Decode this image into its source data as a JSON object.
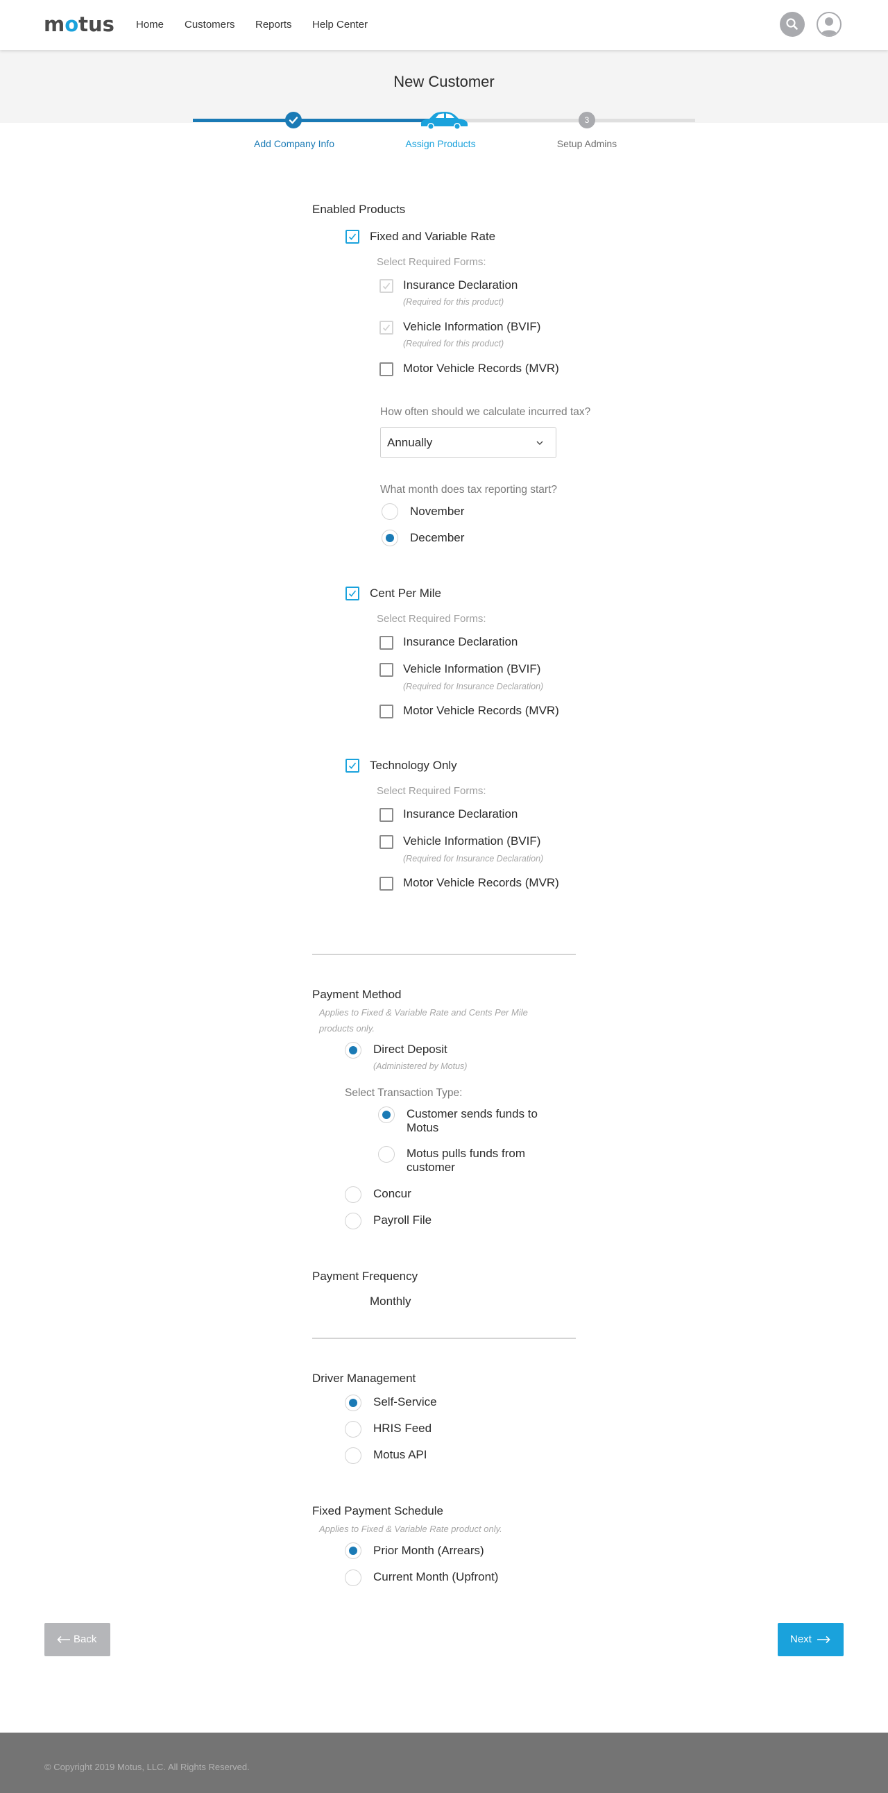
{
  "brand": {
    "logo_prefix": "m",
    "logo_o": "o",
    "logo_suffix": "tus",
    "accent": "#1aa2dc",
    "primary": "#1a7ab5"
  },
  "nav": {
    "items": [
      "Home",
      "Customers",
      "Reports",
      "Help Center"
    ]
  },
  "page": {
    "title": "New Customer"
  },
  "stepper": {
    "steps": [
      {
        "label": "Add Company Info",
        "state": "complete"
      },
      {
        "label": "Assign Products",
        "state": "active"
      },
      {
        "label": "Setup Admins",
        "state": "pending",
        "number": "3"
      }
    ]
  },
  "enabled_products": {
    "title": "Enabled Products",
    "products": [
      {
        "name": "Fixed and Variable Rate",
        "checked": true,
        "forms_label": "Select Required Forms:",
        "forms": [
          {
            "name": "Insurance Declaration",
            "note": "(Required for this product)",
            "state": "disabled-checked"
          },
          {
            "name": "Vehicle Information (BVIF)",
            "note": "(Required for this product)",
            "state": "disabled-checked"
          },
          {
            "name": "Motor Vehicle Records (MVR)",
            "state": "unchecked"
          }
        ],
        "tax_question": "How often should we calculate incurred tax?",
        "tax_select_value": "Annually",
        "month_question": "What month does tax reporting start?",
        "month_options": [
          {
            "label": "November",
            "selected": false
          },
          {
            "label": "December",
            "selected": true
          }
        ]
      },
      {
        "name": "Cent Per Mile",
        "checked": true,
        "forms_label": "Select Required Forms:",
        "forms": [
          {
            "name": "Insurance Declaration",
            "state": "unchecked"
          },
          {
            "name": "Vehicle Information (BVIF)",
            "note": "(Required for Insurance Declaration)",
            "state": "unchecked"
          },
          {
            "name": "Motor Vehicle Records (MVR)",
            "state": "unchecked"
          }
        ]
      },
      {
        "name": "Technology Only",
        "checked": true,
        "forms_label": "Select Required Forms:",
        "forms": [
          {
            "name": "Insurance Declaration",
            "state": "unchecked"
          },
          {
            "name": "Vehicle Information (BVIF)",
            "note": "(Required for Insurance Declaration)",
            "state": "unchecked"
          },
          {
            "name": "Motor Vehicle Records (MVR)",
            "state": "unchecked"
          }
        ]
      }
    ]
  },
  "payment_method": {
    "title": "Payment Method",
    "note_line1": "Applies to Fixed & Variable Rate and Cents Per Mile",
    "note_line2": "products only.",
    "direct_deposit": {
      "label": "Direct Deposit",
      "note": "(Administered by Motus)",
      "selected": true
    },
    "transaction_label": "Select Transaction Type:",
    "transaction_options": [
      {
        "line1": "Customer sends funds to",
        "line2": "Motus",
        "selected": true
      },
      {
        "line1": "Motus pulls funds from",
        "line2": "customer",
        "selected": false
      }
    ],
    "other_options": [
      {
        "label": "Concur",
        "selected": false
      },
      {
        "label": "Payroll File",
        "selected": false
      }
    ]
  },
  "payment_frequency": {
    "title": "Payment Frequency",
    "value": "Monthly"
  },
  "driver_management": {
    "title": "Driver Management",
    "options": [
      {
        "label": "Self-Service",
        "selected": true
      },
      {
        "label": "HRIS Feed",
        "selected": false
      },
      {
        "label": "Motus API",
        "selected": false
      }
    ]
  },
  "fixed_payment_schedule": {
    "title": "Fixed Payment Schedule",
    "note": "Applies to Fixed & Variable Rate product only.",
    "options": [
      {
        "label": "Prior Month (Arrears)",
        "selected": true
      },
      {
        "label": "Current Month (Upfront)",
        "selected": false
      }
    ]
  },
  "actions": {
    "back_label": "Back",
    "next_label": "Next"
  },
  "footer": {
    "copyright": "© Copyright 2019 Motus, LLC. All Rights Reserved."
  }
}
